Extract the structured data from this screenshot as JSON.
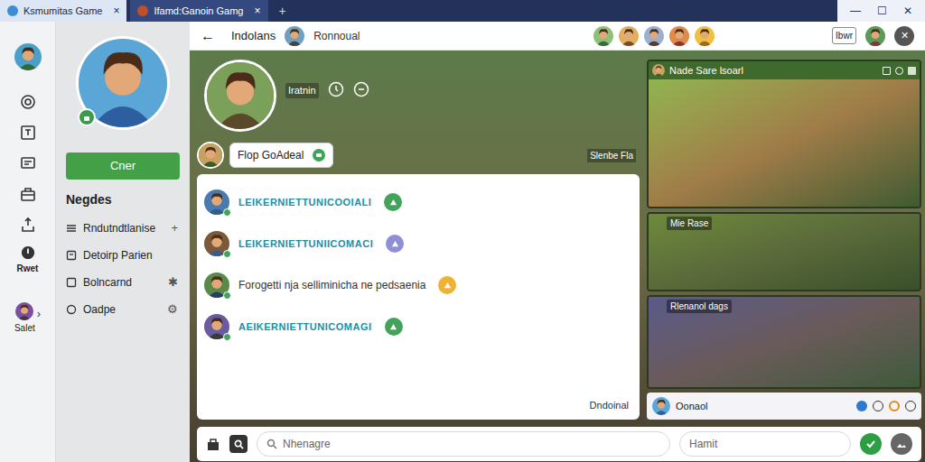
{
  "browser": {
    "tabs": [
      {
        "label": "Ksmumitas Game",
        "close": "×",
        "selected": false
      },
      {
        "label": "Ifamd:Ganoin Gamg",
        "close": "×",
        "selected": true
      }
    ],
    "new_tab": "+",
    "controls": [
      "—",
      "☐",
      "✕"
    ]
  },
  "rail": {
    "items": [
      {
        "label": "Rwet"
      },
      {
        "label": "Salet",
        "chevron": "›"
      }
    ]
  },
  "profile": {
    "button": "Cner"
  },
  "section": {
    "title": "Negdes",
    "items": [
      {
        "label": "Rndutndtlanise",
        "action": "+"
      },
      {
        "label": "Detoirp Parien"
      },
      {
        "label": "Bolncarnd",
        "action": "✱"
      },
      {
        "label": "Oadpe",
        "action": "⚙"
      }
    ]
  },
  "header": {
    "back": "←",
    "title": "Indolans",
    "user": "Ronnoual",
    "badge": "Ibwr",
    "close": "✕"
  },
  "scene": {
    "player": "Iratnin",
    "quest": "Flop GoAdeal",
    "caption": "Slenbe Fla"
  },
  "chat": {
    "messages": [
      {
        "text": "LEIKERNIETTUNICOOIALI",
        "kind": "tag",
        "color": "#43a35a"
      },
      {
        "text": "LEIKERNIETTUNIICOMACI",
        "kind": "tag",
        "color": "#8f8fd8"
      },
      {
        "text": "Forogetti nja selliminicha ne pedsaenia",
        "kind": "plain",
        "color": "#f0b234"
      },
      {
        "text": "AEIKERNIETTUNICOMAGI",
        "kind": "tag",
        "color": "#43a35a"
      }
    ],
    "footer": "Dndoinal"
  },
  "streams": {
    "panels": [
      {
        "title": "Nade Sare lsoarl",
        "kind": "header"
      },
      {
        "title": "Mie Rase",
        "kind": "label"
      },
      {
        "title": "Rlenanol dags",
        "kind": "label"
      }
    ],
    "footer": "Oonaol"
  },
  "composer": {
    "search_placeholder": "Nhenagre",
    "message_placeholder": "Hamit"
  }
}
